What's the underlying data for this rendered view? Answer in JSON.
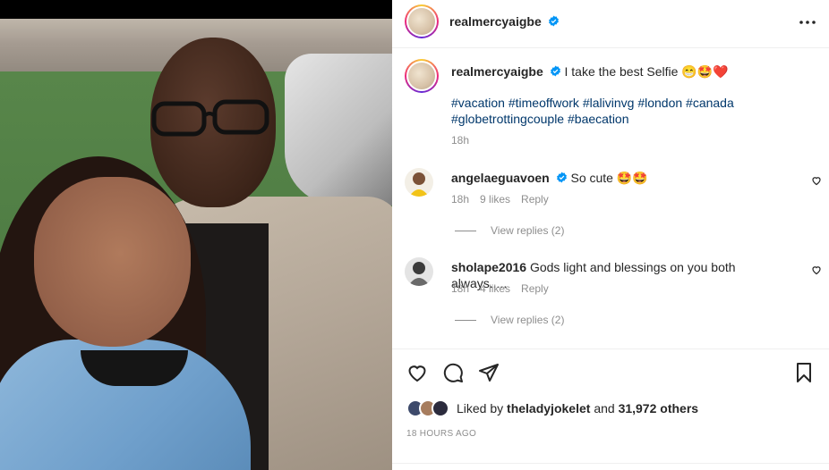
{
  "post": {
    "username": "realmercyaigbe",
    "caption_text": "I take the best Selfie",
    "caption_emojis": "😁🤩❤️",
    "hashtags": [
      "#vacation",
      "#timeoffwork",
      "#lalivinvg",
      "#london",
      "#canada",
      "#globetrottingcouple",
      "#baecation"
    ],
    "caption_time": "18h"
  },
  "comments": [
    {
      "username": "angelaeguavoen",
      "text": "So cute",
      "emojis": "🤩🤩",
      "verified": true,
      "time": "18h",
      "likes": "9 likes",
      "reply_label": "Reply",
      "view_replies": "View replies (2)"
    },
    {
      "username": "sholape2016",
      "text": "Gods light and blessings on you both always.....",
      "verified": false,
      "time": "18h",
      "likes": "4 likes",
      "reply_label": "Reply",
      "view_replies": "View replies (2)"
    }
  ],
  "likes": {
    "prefix": "Liked by",
    "user": "theladyjokelet",
    "joiner": "and",
    "others": "31,972 others"
  },
  "posted_time": "18 HOURS AGO",
  "colors": {
    "hashtag": "#00376b",
    "verified": "#0095f6",
    "muted": "#8e8e8e"
  },
  "icons": [
    "more-options-icon",
    "verified-icon",
    "heart-icon",
    "comment-icon",
    "share-icon",
    "bookmark-icon"
  ]
}
